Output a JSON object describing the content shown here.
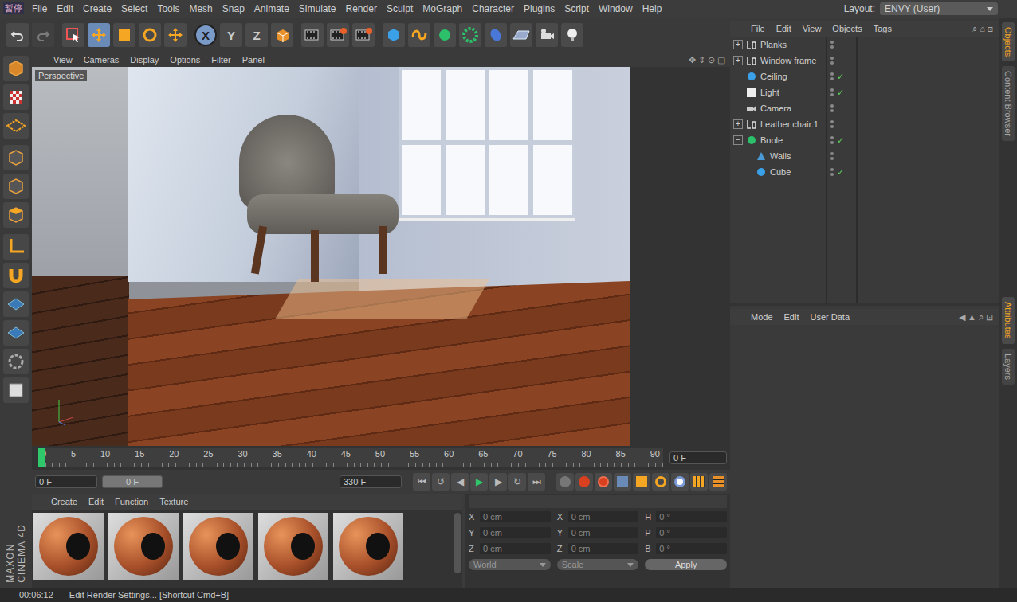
{
  "menu": [
    "File",
    "Edit",
    "Create",
    "Select",
    "Tools",
    "Mesh",
    "Snap",
    "Animate",
    "Simulate",
    "Render",
    "Sculpt",
    "MoGraph",
    "Character",
    "Plugins",
    "Script",
    "Window",
    "Help"
  ],
  "overlay": "暂停",
  "layout": {
    "label": "Layout:",
    "value": "ENVY (User)"
  },
  "axes": [
    {
      "label": "X",
      "selected": true
    },
    {
      "label": "Y",
      "selected": false
    },
    {
      "label": "Z",
      "selected": false
    }
  ],
  "viewport": {
    "menu": [
      "View",
      "Cameras",
      "Display",
      "Options",
      "Filter",
      "Panel"
    ],
    "label": "Perspective"
  },
  "objectManager": {
    "menu": [
      "File",
      "Edit",
      "View",
      "Objects",
      "Tags"
    ],
    "objects": [
      {
        "name": "Planks",
        "kind": "null",
        "depth": 0,
        "expandable": true,
        "expanded": false,
        "enabled": false
      },
      {
        "name": "Window frame",
        "kind": "null",
        "depth": 0,
        "expandable": true,
        "expanded": false,
        "enabled": false
      },
      {
        "name": "Ceiling",
        "kind": "primitive",
        "depth": 0,
        "expandable": false,
        "expanded": false,
        "enabled": true
      },
      {
        "name": "Light",
        "kind": "light",
        "depth": 0,
        "expandable": false,
        "expanded": false,
        "enabled": true
      },
      {
        "name": "Camera",
        "kind": "camera",
        "depth": 0,
        "expandable": false,
        "expanded": false,
        "enabled": false
      },
      {
        "name": "Leather chair.1",
        "kind": "null",
        "depth": 0,
        "expandable": true,
        "expanded": false,
        "enabled": false
      },
      {
        "name": "Boole",
        "kind": "boole",
        "depth": 0,
        "expandable": true,
        "expanded": true,
        "enabled": true
      },
      {
        "name": "Walls",
        "kind": "polygon",
        "depth": 1,
        "expandable": false,
        "expanded": false,
        "enabled": false
      },
      {
        "name": "Cube",
        "kind": "primitive",
        "depth": 1,
        "expandable": false,
        "expanded": false,
        "enabled": true
      }
    ]
  },
  "attributes": {
    "menu": [
      "Mode",
      "Edit",
      "User Data"
    ]
  },
  "sideTabs": [
    {
      "label": "Objects",
      "selected": true
    },
    {
      "label": "Content Browser",
      "selected": false
    },
    {
      "label": "Attributes",
      "selected": true
    },
    {
      "label": "Layers",
      "selected": false
    }
  ],
  "timeline": {
    "ticks": [
      "0",
      "5",
      "10",
      "15",
      "20",
      "25",
      "30",
      "35",
      "40",
      "45",
      "50",
      "55",
      "60",
      "65",
      "70",
      "75",
      "80",
      "85",
      "90"
    ],
    "playhead": 0,
    "frame": "0 F"
  },
  "transport": {
    "start": "0 F",
    "current": "0 F",
    "end": "330 F"
  },
  "materials": {
    "menu": [
      "Create",
      "Edit",
      "Function",
      "Texture"
    ],
    "items": [
      {
        "selected": false
      },
      {
        "selected": false
      },
      {
        "selected": false
      },
      {
        "selected": false
      },
      {
        "selected": false
      }
    ]
  },
  "coordinates": {
    "rows": [
      [
        {
          "axis": "X",
          "value": "0 cm"
        },
        {
          "axis": "X",
          "value": "0 cm"
        },
        {
          "axis": "H",
          "value": "0 °"
        }
      ],
      [
        {
          "axis": "Y",
          "value": "0 cm"
        },
        {
          "axis": "Y",
          "value": "0 cm"
        },
        {
          "axis": "P",
          "value": "0 °"
        }
      ],
      [
        {
          "axis": "Z",
          "value": "0 cm"
        },
        {
          "axis": "Z",
          "value": "0 cm"
        },
        {
          "axis": "B",
          "value": "0 °"
        }
      ]
    ],
    "mode": "World",
    "sizeMode": "Scale",
    "apply": "Apply"
  },
  "brand": [
    "MAXON",
    "CINEMA 4D"
  ],
  "status": {
    "time": "00:06:12",
    "message": "Edit Render Settings... [Shortcut Cmd+B]"
  }
}
